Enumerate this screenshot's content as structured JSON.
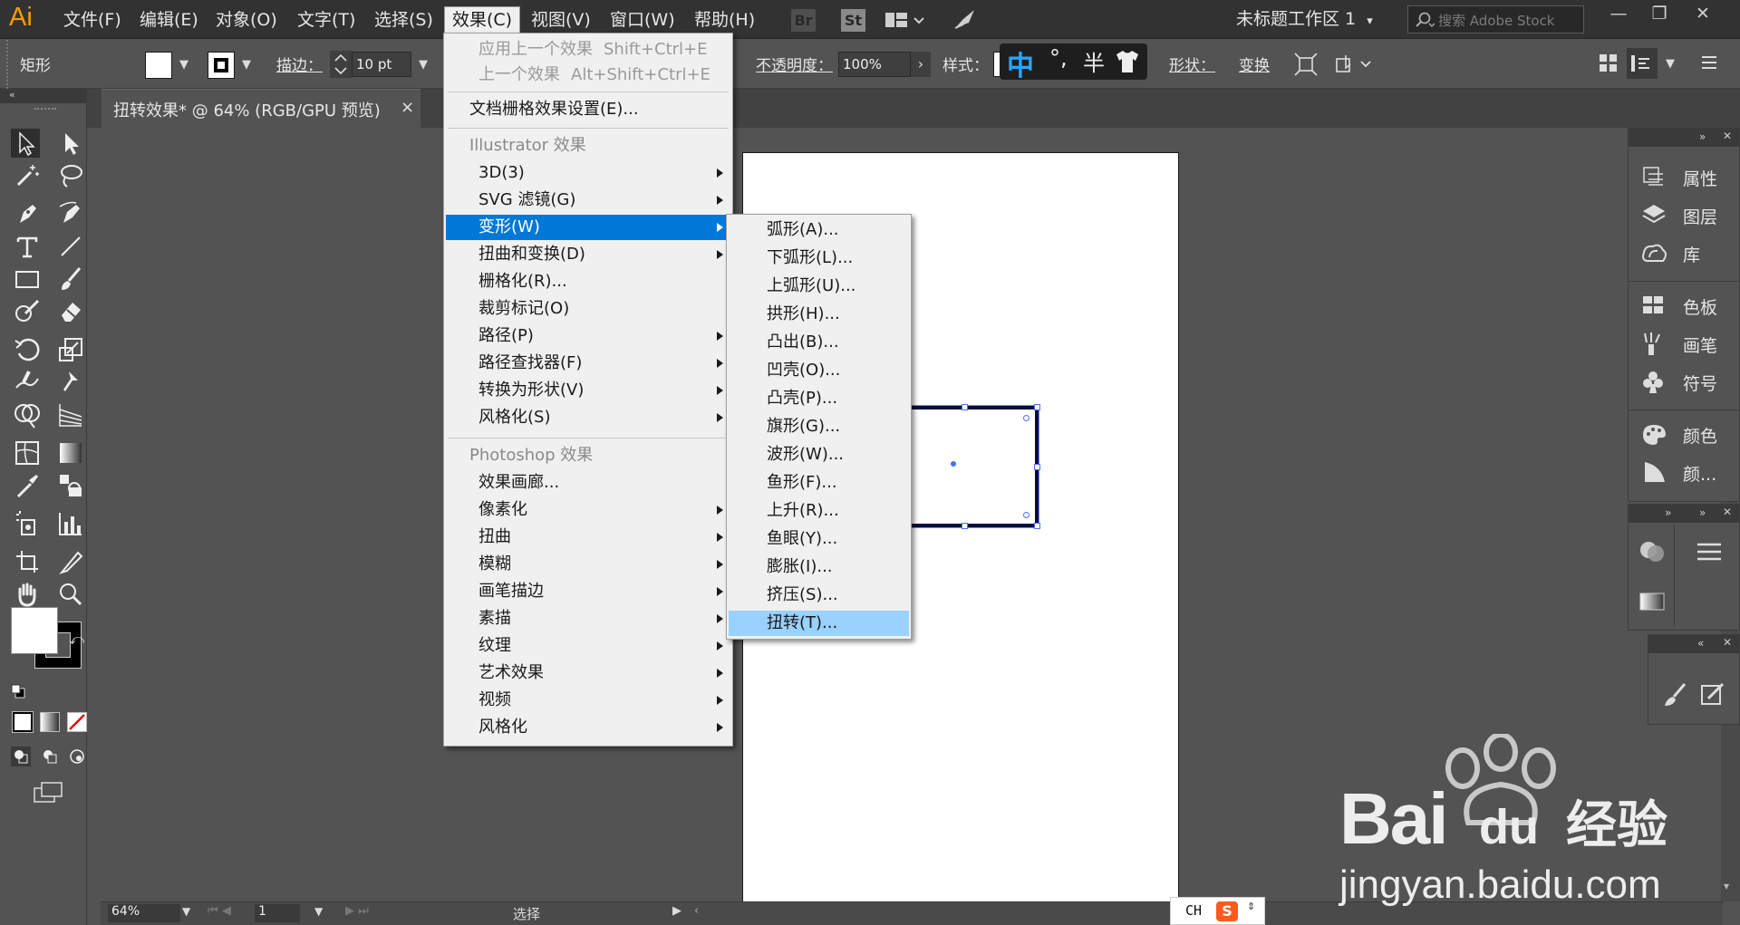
{
  "app": {
    "logo": "Ai"
  },
  "menubar": {
    "items": [
      "文件(F)",
      "编辑(E)",
      "对象(O)",
      "文字(T)",
      "选择(S)",
      "效果(C)",
      "视图(V)",
      "窗口(W)",
      "帮助(H)"
    ],
    "bridge_icon": "Br",
    "stock_icon": "St",
    "workspace": "未标题工作区 1",
    "search_placeholder": "搜索 Adobe Stock"
  },
  "control_bar": {
    "shape_label": "矩形",
    "stroke_label": "描边：",
    "stroke_value": "10 pt",
    "opacity_label": "不透明度：",
    "opacity_value": "100%",
    "style_label": "样式：",
    "shape_btn": "形状：",
    "transform_btn": "变换"
  },
  "ime_toolbar": {
    "mode": "中",
    "punct": "°,",
    "width": "半"
  },
  "document_tab": {
    "title": "扭转效果* @ 64% (RGB/GPU 预览)",
    "close": "×"
  },
  "effect_menu": {
    "items": [
      {
        "label": "应用上一个效果",
        "shortcut": "Shift+Ctrl+E",
        "disabled": true
      },
      {
        "label": "上一个效果",
        "shortcut": "Alt+Shift+Ctrl+E",
        "disabled": true
      },
      {
        "label": "文档栅格效果设置(E)..."
      },
      {
        "label": "Illustrator 效果",
        "header": true
      },
      {
        "label": "3D(3)",
        "submenu": true
      },
      {
        "label": "SVG 滤镜(G)",
        "submenu": true
      },
      {
        "label": "变形(W)",
        "submenu": true,
        "selected": true
      },
      {
        "label": "扭曲和变换(D)",
        "submenu": true
      },
      {
        "label": "栅格化(R)..."
      },
      {
        "label": "裁剪标记(O)"
      },
      {
        "label": "路径(P)",
        "submenu": true
      },
      {
        "label": "路径查找器(F)",
        "submenu": true
      },
      {
        "label": "转换为形状(V)",
        "submenu": true
      },
      {
        "label": "风格化(S)",
        "submenu": true
      },
      {
        "label": "Photoshop 效果",
        "header": true
      },
      {
        "label": "效果画廊..."
      },
      {
        "label": "像素化",
        "submenu": true
      },
      {
        "label": "扭曲",
        "submenu": true
      },
      {
        "label": "模糊",
        "submenu": true
      },
      {
        "label": "画笔描边",
        "submenu": true
      },
      {
        "label": "素描",
        "submenu": true
      },
      {
        "label": "纹理",
        "submenu": true
      },
      {
        "label": "艺术效果",
        "submenu": true
      },
      {
        "label": "视频",
        "submenu": true
      },
      {
        "label": "风格化",
        "submenu": true
      }
    ]
  },
  "warp_submenu": {
    "items": [
      "弧形(A)...",
      "下弧形(L)...",
      "上弧形(U)...",
      "拱形(H)...",
      "凸出(B)...",
      "凹壳(O)...",
      "凸壳(P)...",
      "旗形(G)...",
      "波形(W)...",
      "鱼形(F)...",
      "上升(R)...",
      "鱼眼(Y)...",
      "膨胀(I)...",
      "挤压(S)...",
      "扭转(T)..."
    ],
    "highlighted": "扭转(T)..."
  },
  "right_panels": {
    "group1": [
      "属性",
      "图层",
      "库"
    ],
    "group2": [
      "色板",
      "画笔",
      "符号"
    ],
    "group3": [
      "颜色",
      "颜..."
    ]
  },
  "status_bar": {
    "zoom": "64%",
    "page": "1",
    "status": "选择"
  },
  "taskbar": {
    "ime": "CH"
  },
  "watermark": {
    "brand": "Bai",
    "brand2": "du",
    "cn": "经验",
    "url": "jingyan.baidu.com"
  },
  "colors": {
    "menubar_bg": "#323232",
    "panel_bg": "#535353",
    "menu_selected": "#0078d7",
    "submenu_highlight": "#99d1ff",
    "logo": "#ff9a00"
  }
}
